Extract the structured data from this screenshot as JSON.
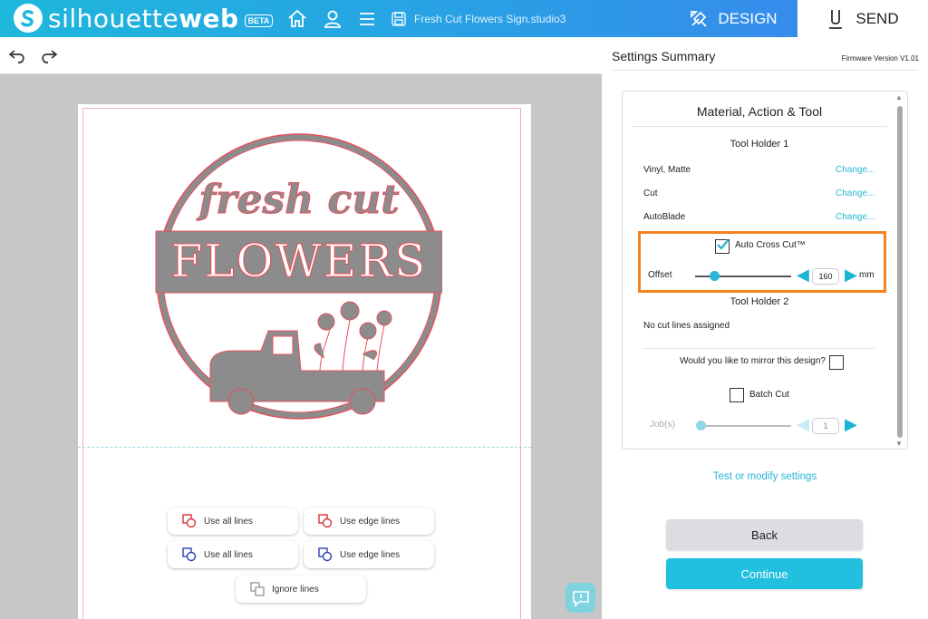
{
  "app": {
    "logo_text_light": "silhouette",
    "logo_text_bold": "web",
    "beta_badge": "BETA",
    "document_title": "Fresh Cut Flowers Sign.studio3",
    "accent": "#1fb7dc",
    "highlight_color": "#f5821f"
  },
  "header": {
    "icons": [
      "home-icon",
      "user-icon",
      "menu-icon",
      "save-icon"
    ],
    "tabs": [
      {
        "label": "DESIGN",
        "icon": "design-icon",
        "active": false
      },
      {
        "label": "SEND",
        "icon": "send-icon",
        "active": true
      }
    ]
  },
  "toolbar": {
    "icons": [
      "undo-icon",
      "redo-icon"
    ]
  },
  "design": {
    "line1": "fresh cut",
    "line2": "FLOWERS"
  },
  "line_buttons": [
    {
      "label": "Use all lines",
      "icon": "use-all-lines-red-icon"
    },
    {
      "label": "Use edge lines",
      "icon": "use-edge-lines-red-icon"
    },
    {
      "label": "Use all lines",
      "icon": "use-all-lines-blue-icon"
    },
    {
      "label": "Use edge lines",
      "icon": "use-edge-lines-blue-icon"
    },
    {
      "label": "Ignore lines",
      "icon": "ignore-lines-icon"
    }
  ],
  "settings": {
    "title": "Settings Summary",
    "firmware": "Firmware Version V1.01",
    "section_title": "Material, Action & Tool",
    "tool_holder_1": {
      "title": "Tool Holder 1",
      "rows": [
        {
          "label": "Vinyl, Matte",
          "link": "Change..."
        },
        {
          "label": "Cut",
          "link": "Change..."
        },
        {
          "label": "AutoBlade",
          "link": "Change..."
        }
      ],
      "auto_cross_cut": {
        "label": "Auto Cross Cut™",
        "checked": true
      },
      "offset": {
        "label": "Offset",
        "value": "160",
        "unit": "mm",
        "level": 0.2
      }
    },
    "tool_holder_2": {
      "title": "Tool Holder 2",
      "message": "No cut lines assigned"
    },
    "mirror": {
      "label": "Would you like to mirror this design?",
      "checked": false
    },
    "batch_cut": {
      "label": "Batch Cut",
      "checked": false
    },
    "jobs": {
      "label": "Job(s)",
      "value": "1",
      "level": 0.0
    }
  },
  "actions": {
    "test_link": "Test or modify settings",
    "back": "Back",
    "continue": "Continue"
  }
}
